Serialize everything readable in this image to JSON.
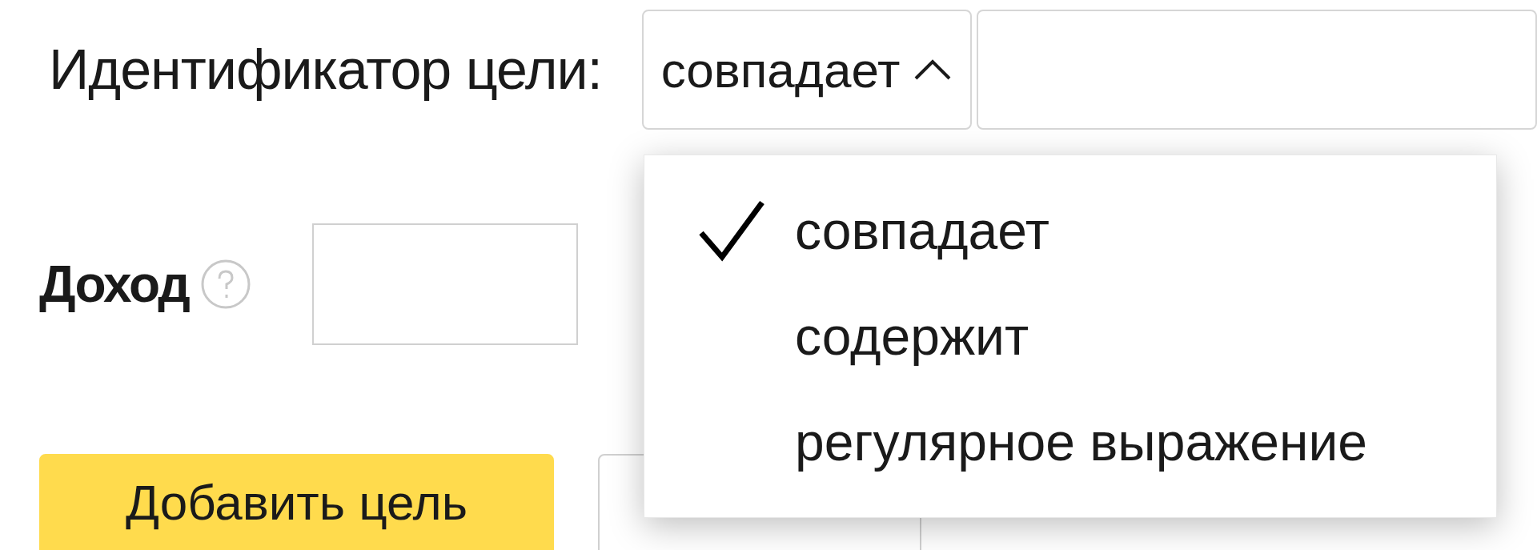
{
  "goal_id": {
    "label": "Идентификатор цели:",
    "match": {
      "value": "совпадает",
      "expanded": true
    },
    "options": [
      {
        "label": "совпадает",
        "selected": true
      },
      {
        "label": "содержит",
        "selected": false
      },
      {
        "label": "регулярное выражение",
        "selected": false
      }
    ]
  },
  "income": {
    "label": "Доход"
  },
  "buttons": [
    {
      "label": "Добавить цель",
      "kind": "primary"
    },
    {
      "kind": "secondary"
    }
  ]
}
